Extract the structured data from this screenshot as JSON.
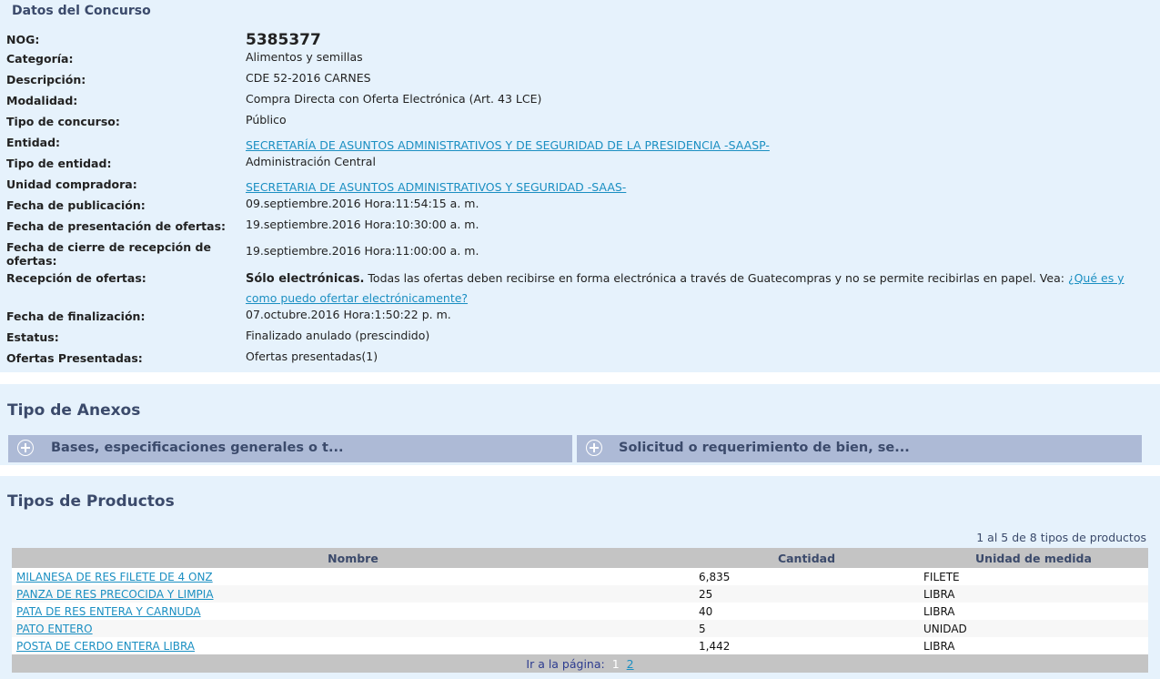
{
  "datos": {
    "title": "Datos del Concurso",
    "fields": [
      {
        "label": "NOG:",
        "value": "5385377"
      },
      {
        "label": "Categoría:",
        "value": "Alimentos y semillas"
      },
      {
        "label": "Descripción:",
        "value": "CDE 52-2016 CARNES"
      },
      {
        "label": "Modalidad:",
        "value": "Compra Directa con Oferta Electrónica (Art. 43 LCE)"
      },
      {
        "label": "Tipo de concurso:",
        "value": "Público"
      },
      {
        "label": "Entidad:",
        "value": "SECRETARÍA DE ASUNTOS ADMINISTRATIVOS Y DE SEGURIDAD DE LA PRESIDENCIA -SAASP-"
      },
      {
        "label": "Tipo de entidad:",
        "value": "Administración Central"
      },
      {
        "label": "Unidad compradora:",
        "value": "SECRETARIA DE ASUNTOS ADMINISTRATIVOS Y SEGURIDAD -SAAS-"
      },
      {
        "label": "Fecha de publicación:",
        "value": "09.septiembre.2016 Hora:11:54:15 a. m."
      },
      {
        "label": "Fecha de presentación de ofertas:",
        "value": "19.septiembre.2016 Hora:10:30:00 a. m."
      },
      {
        "label": "Fecha de cierre de recepción de ofertas:",
        "value": "19.septiembre.2016 Hora:11:00:00 a. m."
      },
      {
        "label": "Recepción de ofertas:",
        "value_bold": "Sólo electrónicas.",
        "value": "Todas las ofertas deben recibirse en forma electrónica a través de Guatecompras y no se permite recibirlas en papel. Vea:",
        "link": "¿Qué es y como puedo ofertar electrónicamente?"
      },
      {
        "label": "Fecha de finalización:",
        "value": "07.octubre.2016 Hora:1:50:22 p. m."
      },
      {
        "label": "Estatus:",
        "value": "Finalizado anulado (prescindido)"
      },
      {
        "label": "Ofertas Presentadas:",
        "value": "Ofertas presentadas(1)"
      }
    ]
  },
  "anexos": {
    "title": "Tipo de Anexos",
    "items": [
      {
        "label": "Bases, especificaciones generales o t...",
        "icon": "plus-circle-icon"
      },
      {
        "label": "Solicitud o requerimiento de bien, se...",
        "icon": "plus-circle-icon"
      }
    ]
  },
  "productos": {
    "title": "Tipos de Productos",
    "count_text": "1 al 5 de 8 tipos de productos",
    "columns": [
      "Nombre",
      "Cantidad",
      "Unidad de medida"
    ],
    "rows": [
      {
        "nombre": "MILANESA DE RES FILETE DE 4 ONZ",
        "cantidad": "6,835",
        "unidad": "FILETE"
      },
      {
        "nombre": "PANZA DE RES PRECOCIDA Y LIMPIA",
        "cantidad": "25",
        "unidad": "LIBRA"
      },
      {
        "nombre": "PATA DE RES ENTERA Y CARNUDA",
        "cantidad": "40",
        "unidad": "LIBRA"
      },
      {
        "nombre": "PATO ENTERO",
        "cantidad": "5",
        "unidad": "UNIDAD"
      },
      {
        "nombre": "POSTA DE CERDO ENTERA LIBRA",
        "cantidad": "1,442",
        "unidad": "LIBRA"
      }
    ],
    "pager": {
      "label": "Ir a la página:",
      "current": "1",
      "next": "2"
    }
  },
  "colors": {
    "panel_bg": "#e6f2fc",
    "heading": "#3b4a6b",
    "link": "#1b8fc2",
    "accordion_bg": "#adbad6",
    "table_header_bg": "#c4c4c4"
  }
}
